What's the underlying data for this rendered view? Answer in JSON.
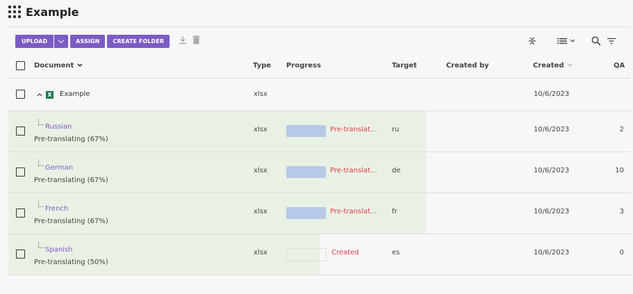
{
  "app": {
    "title": "Example"
  },
  "toolbar": {
    "upload": "UPLOAD",
    "assign": "ASSIGN",
    "create_folder": "CREATE FOLDER"
  },
  "columns": {
    "document": "Document",
    "type": "Type",
    "progress": "Progress",
    "target": "Target",
    "created_by": "Created by",
    "created": "Created",
    "qa": "QA"
  },
  "parent": {
    "name": "Example",
    "type": "xlsx",
    "created": "10/6/2023"
  },
  "rows": [
    {
      "name": "Russian",
      "status": "Pre-translating (67%)",
      "type": "xlsx",
      "progress_label": "Pre-translat...",
      "progress_fraction": 0.67,
      "target": "ru",
      "created": "10/6/2023",
      "qa": "2"
    },
    {
      "name": "German",
      "status": "Pre-translating (67%)",
      "type": "xlsx",
      "progress_label": "Pre-translat...",
      "progress_fraction": 0.67,
      "target": "de",
      "created": "10/6/2023",
      "qa": "10"
    },
    {
      "name": "French",
      "status": "Pre-translating (67%)",
      "type": "xlsx",
      "progress_label": "Pre-translat...",
      "progress_fraction": 0.67,
      "target": "fr",
      "created": "10/6/2023",
      "qa": "3"
    },
    {
      "name": "Spanish",
      "status": "Pre-translating (50%)",
      "type": "xlsx",
      "progress_label": "Created",
      "progress_fraction": 0.5,
      "target": "es",
      "created": "10/6/2023",
      "qa": "0"
    }
  ],
  "icons": {
    "apps": "grid-icon",
    "download": "download-icon",
    "delete": "trash-icon",
    "collapse": "collapse-icon",
    "list": "list-view-icon",
    "search": "search-icon",
    "filter": "filter-icon",
    "sort": "sort-arrow-icon",
    "expand": "chevron-up-icon",
    "file": "excel-file-icon"
  },
  "colors": {
    "accent": "#7c5cc4",
    "status": "#e63a4a",
    "row_progress": "#e9f1e5",
    "bar": "#b8c8e8",
    "file_icon": "#1d7a4a"
  }
}
